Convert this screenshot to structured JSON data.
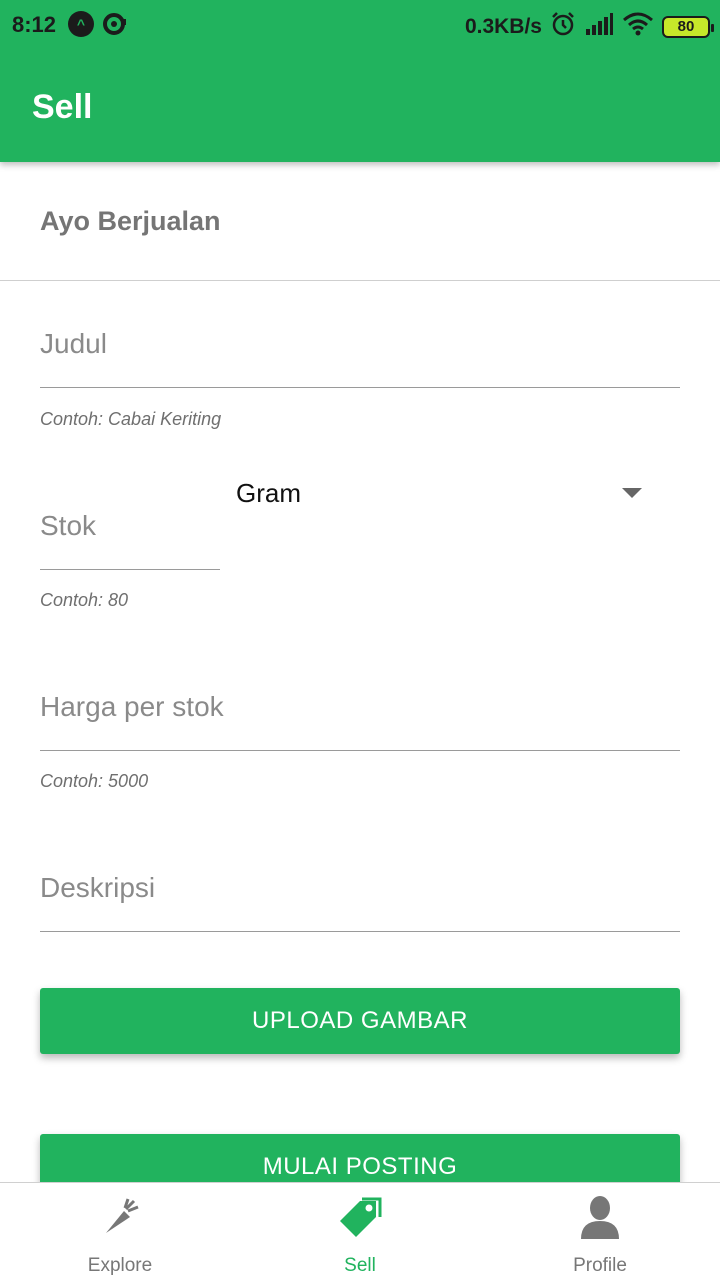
{
  "status_bar": {
    "time": "8:12",
    "net_speed": "0.3KB/s",
    "battery": "80"
  },
  "app_bar": {
    "title": "Sell"
  },
  "form": {
    "header": "Ayo Berjualan",
    "judul": {
      "placeholder": "Judul",
      "hint": "Contoh: Cabai Keriting"
    },
    "stok": {
      "placeholder": "Stok",
      "hint": "Contoh: 80"
    },
    "unit_select": {
      "selected": "Gram"
    },
    "harga": {
      "placeholder": "Harga per stok",
      "hint": "Contoh: 5000"
    },
    "deskripsi": {
      "placeholder": "Deskripsi"
    },
    "upload_button": "UPLOAD GAMBAR",
    "post_button": "MULAI POSTING"
  },
  "bottom_nav": {
    "items": [
      {
        "label": "Explore",
        "icon": "carrot-icon"
      },
      {
        "label": "Sell",
        "icon": "tag-icon"
      },
      {
        "label": "Profile",
        "icon": "person-icon"
      }
    ],
    "active": "Sell"
  },
  "colors": {
    "primary": "#21b35e",
    "inactive_nav": "#777777"
  }
}
